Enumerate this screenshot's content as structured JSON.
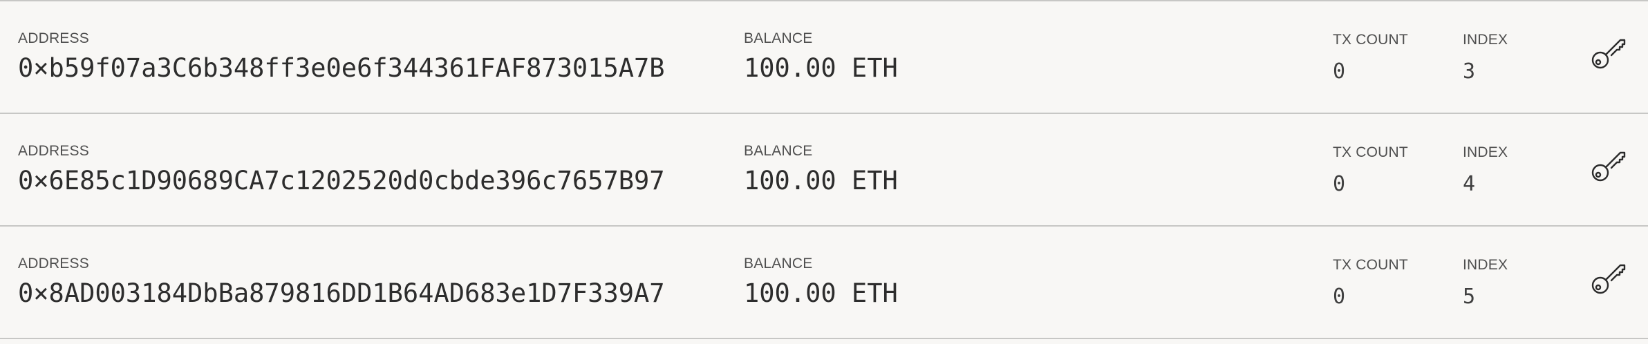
{
  "labels": {
    "address": "ADDRESS",
    "balance": "BALANCE",
    "tx_count": "TX COUNT",
    "index": "INDEX"
  },
  "accounts": [
    {
      "address": "0×b59f07a3C6b348ff3e0e6f344361FAF873015A7B",
      "balance": "100.00 ETH",
      "tx_count": "0",
      "index": "3",
      "action_icon": "key-icon"
    },
    {
      "address": "0×6E85c1D90689CA7c1202520d0cbde396c7657B97",
      "balance": "100.00 ETH",
      "tx_count": "0",
      "index": "4",
      "action_icon": "key-icon"
    },
    {
      "address": "0×8AD003184DbBa879816DD1B64AD683e1D7F339A7",
      "balance": "100.00 ETH",
      "tx_count": "0",
      "index": "5",
      "action_icon": "key-icon"
    }
  ],
  "colors": {
    "background": "#f8f7f5",
    "divider": "#c7c7c5",
    "label": "#4f4f4f",
    "value": "#2d2d2d"
  }
}
